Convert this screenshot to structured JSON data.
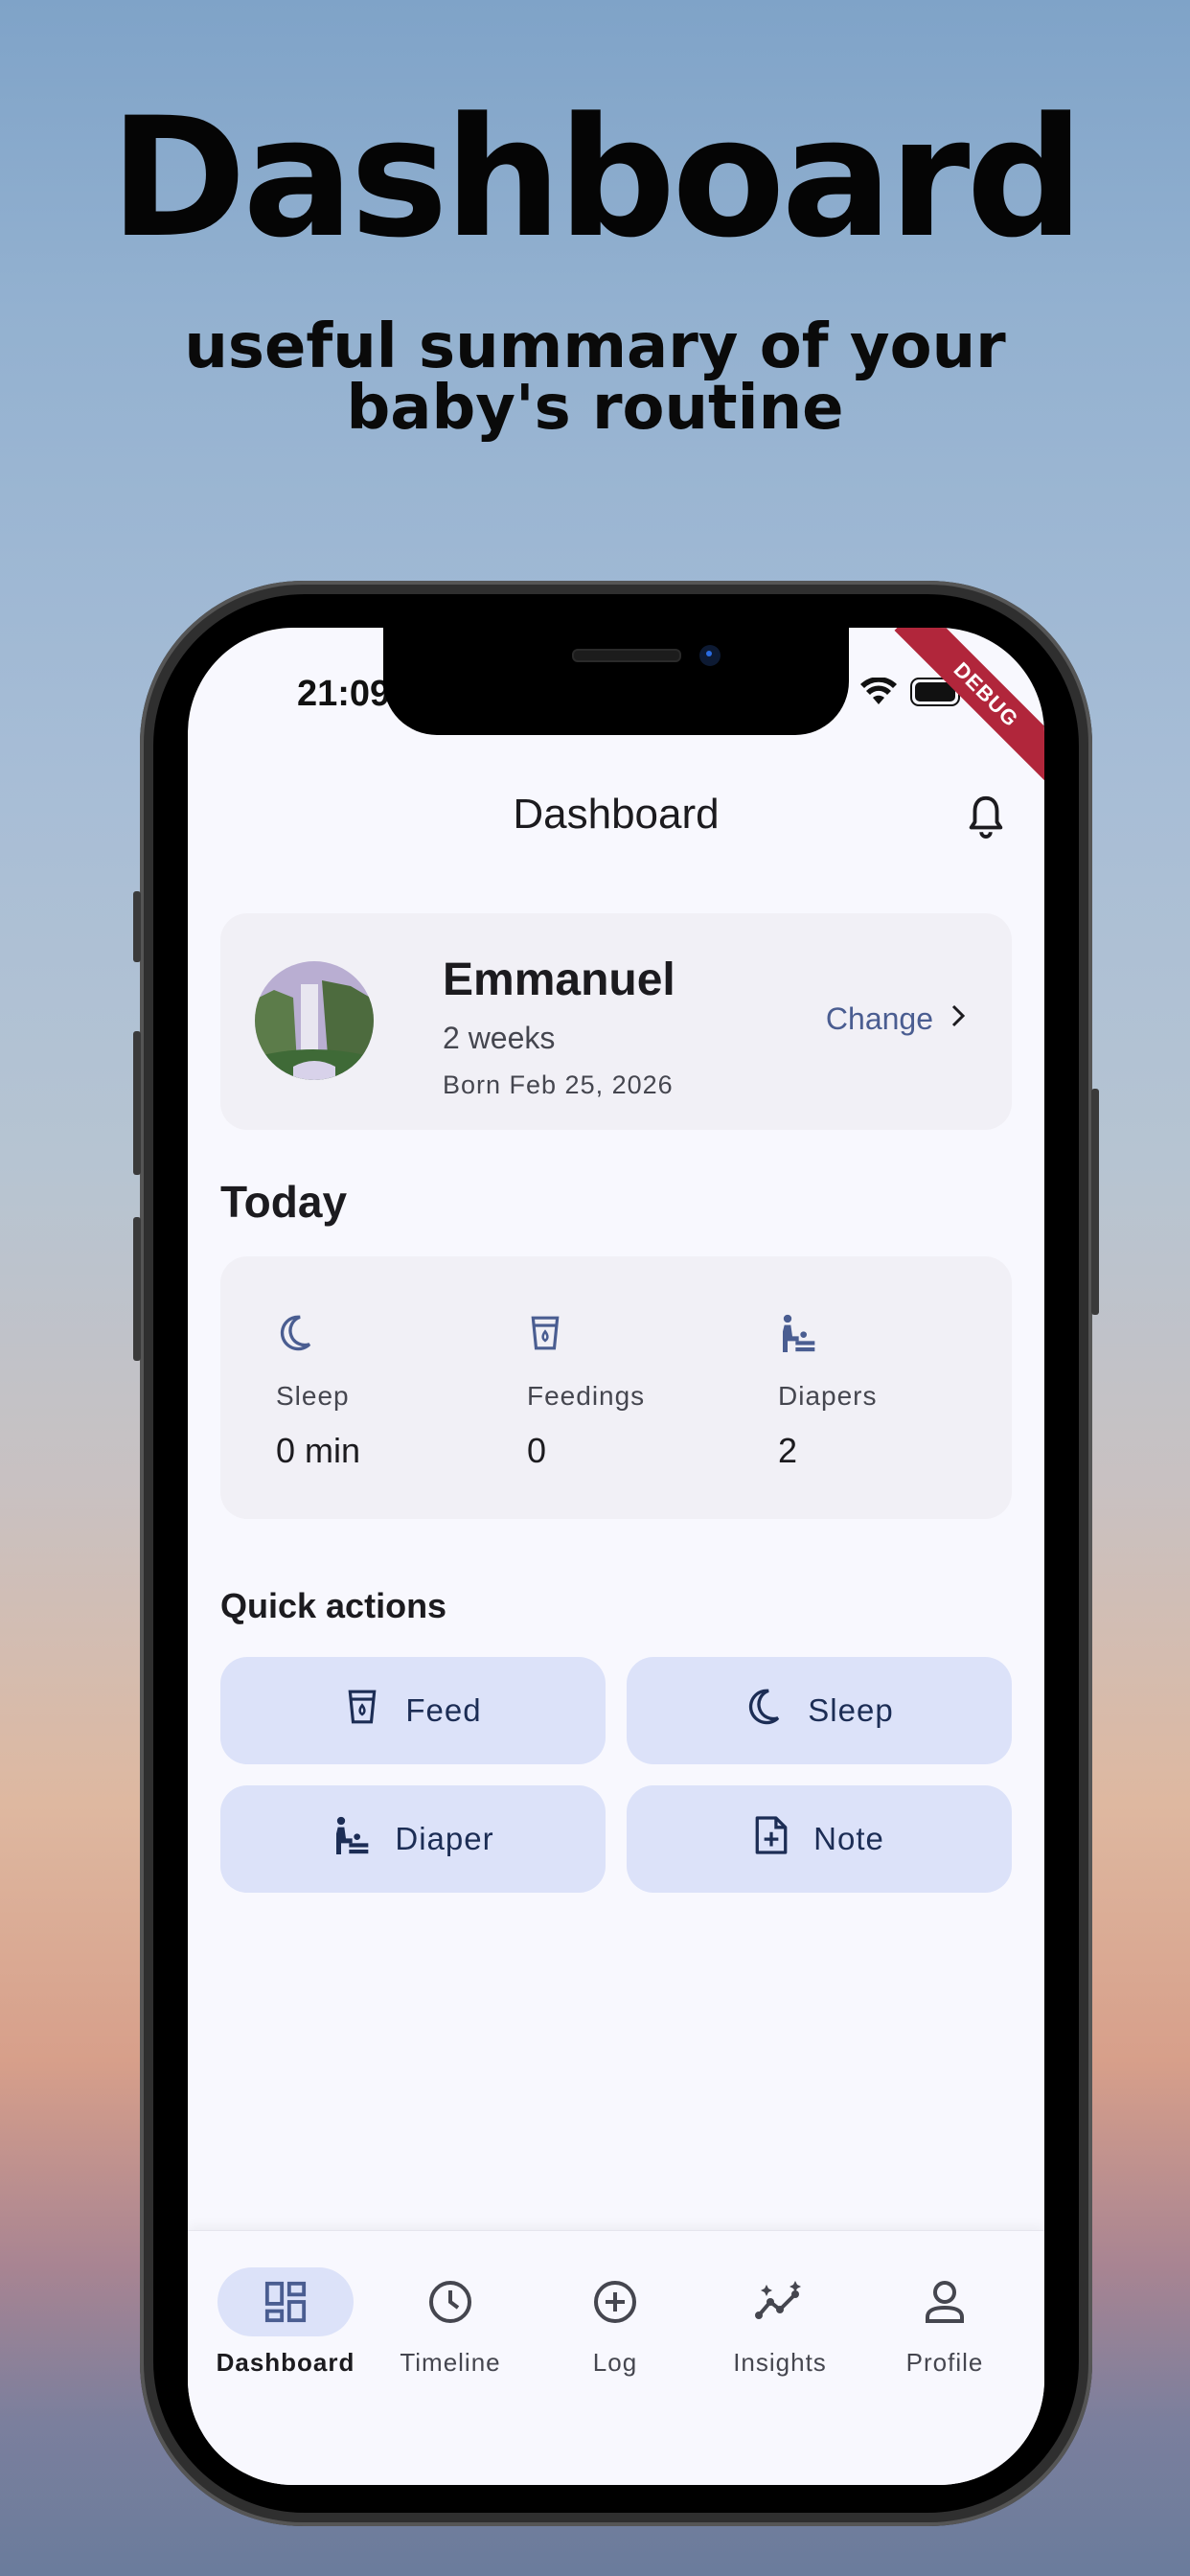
{
  "promo": {
    "headline": "Dashboard",
    "subline_1": "useful summary of your",
    "subline_2": "baby's routine"
  },
  "status_bar": {
    "time": "21:09",
    "debug_label": "DEBUG"
  },
  "app_bar": {
    "title": "Dashboard",
    "action_icon": "bell-icon"
  },
  "child": {
    "name": "Emmanuel",
    "age": "2 weeks",
    "born": "Born Feb 25, 2026",
    "change_label": "Change"
  },
  "today": {
    "title": "Today",
    "stats": [
      {
        "label": "Sleep",
        "value": "0 min",
        "icon": "moon-icon"
      },
      {
        "label": "Feedings",
        "value": "0",
        "icon": "cup-icon"
      },
      {
        "label": "Diapers",
        "value": "2",
        "icon": "baby-changing-icon"
      }
    ]
  },
  "quick_actions": {
    "title": "Quick actions",
    "items": [
      {
        "label": "Feed",
        "icon": "cup-icon"
      },
      {
        "label": "Sleep",
        "icon": "moon-icon"
      },
      {
        "label": "Diaper",
        "icon": "baby-changing-icon"
      },
      {
        "label": "Note",
        "icon": "note-add-icon"
      }
    ]
  },
  "bottom_nav": {
    "items": [
      {
        "label": "Dashboard",
        "icon": "dashboard-icon",
        "active": true
      },
      {
        "label": "Timeline",
        "icon": "clock-icon",
        "active": false
      },
      {
        "label": "Log",
        "icon": "add-circle-icon",
        "active": false
      },
      {
        "label": "Insights",
        "icon": "insights-icon",
        "active": false
      },
      {
        "label": "Profile",
        "icon": "person-icon",
        "active": false
      }
    ]
  },
  "colors": {
    "accent": "#4a5d91",
    "chip": "#dce2f9",
    "card": "#f1f0f6",
    "surface": "#f8f8fe"
  }
}
